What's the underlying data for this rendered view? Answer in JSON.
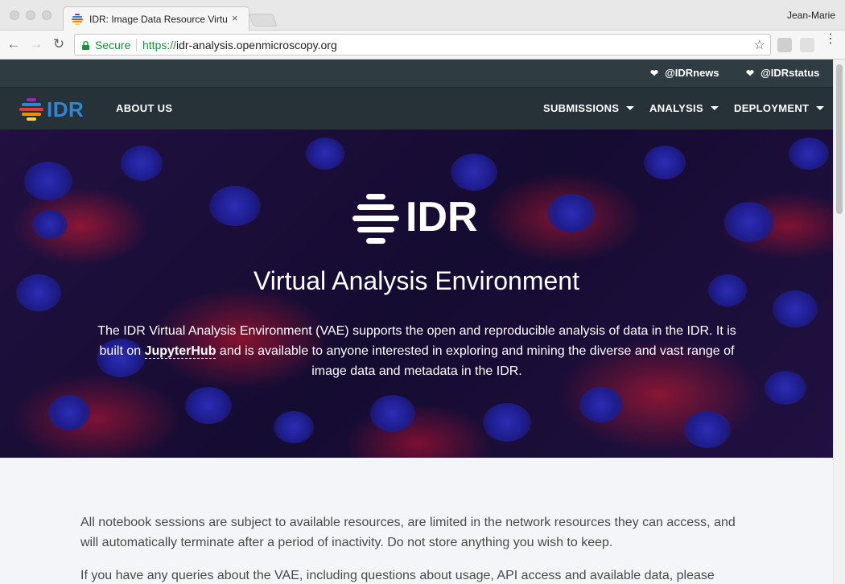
{
  "browser": {
    "tab_title": "IDR: Image Data Resource Virtu",
    "tab_close": "×",
    "user": "Jean-Marie",
    "secure_label": "Secure",
    "url_scheme": "https://",
    "url_host": "idr-analysis.openmicroscopy.org",
    "icons": [
      "back-icon",
      "forward-icon",
      "reload-icon",
      "lock-icon",
      "star-icon",
      "extension-icon",
      "menu-icon"
    ]
  },
  "topbar": {
    "links": [
      {
        "label": "@IDRnews",
        "icon": "twitter-icon"
      },
      {
        "label": "@IDRstatus",
        "icon": "twitter-icon"
      }
    ]
  },
  "nav": {
    "logo_text": "IDR",
    "about": "ABOUT US",
    "submissions": "SUBMISSIONS",
    "analysis": "ANALYSIS",
    "deployment": "DEPLOYMENT"
  },
  "hero": {
    "logo_text": "IDR",
    "title": "Virtual Analysis Environment",
    "desc_before": "The IDR Virtual Analysis Environment (VAE) supports the open and reproducible analysis of data in the IDR. It is built on ",
    "desc_link": "JupyterHub",
    "desc_after": " and is available to anyone interested in exploring and mining the diverse and vast range of image data and metadata in the IDR."
  },
  "content": {
    "p1": "All notebook sessions are subject to available resources, are limited in the network resources they can access, and will automatically terminate after a period of inactivity. Do not store anything you wish to keep.",
    "p2": "If you have any queries about the VAE, including questions about usage, API access and available data, please"
  },
  "colors": {
    "topbar": "#2f3c42",
    "navbar": "#263238",
    "logo_blue": "#2f86d6",
    "secure_green": "#1e8e3e",
    "page_bg": "#f4f5f8"
  }
}
